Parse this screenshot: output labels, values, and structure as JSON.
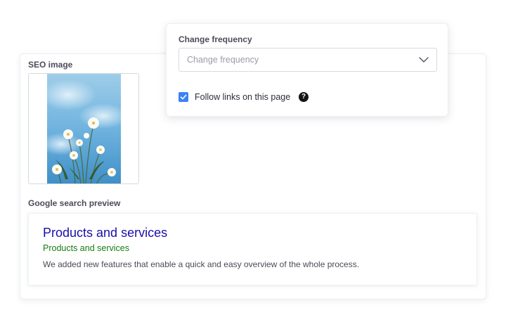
{
  "seo": {
    "image_label": "SEO image",
    "preview_label": "Google search preview",
    "preview": {
      "title": "Products and services",
      "url": "Products and services",
      "description": "We added new features that enable a quick and easy overview of the whole process."
    }
  },
  "frequency": {
    "label": "Change frequency",
    "placeholder": "Change frequency",
    "follow_links_label": "Follow links on this page",
    "follow_links_checked": true,
    "help_glyph": "?"
  },
  "colors": {
    "link_title": "#1a0dab",
    "url_green": "#137d13",
    "checkbox_blue": "#3b82f6"
  },
  "icons": [
    "chevron-down-icon",
    "checkmark-icon",
    "help-icon",
    "flowers-image"
  ]
}
